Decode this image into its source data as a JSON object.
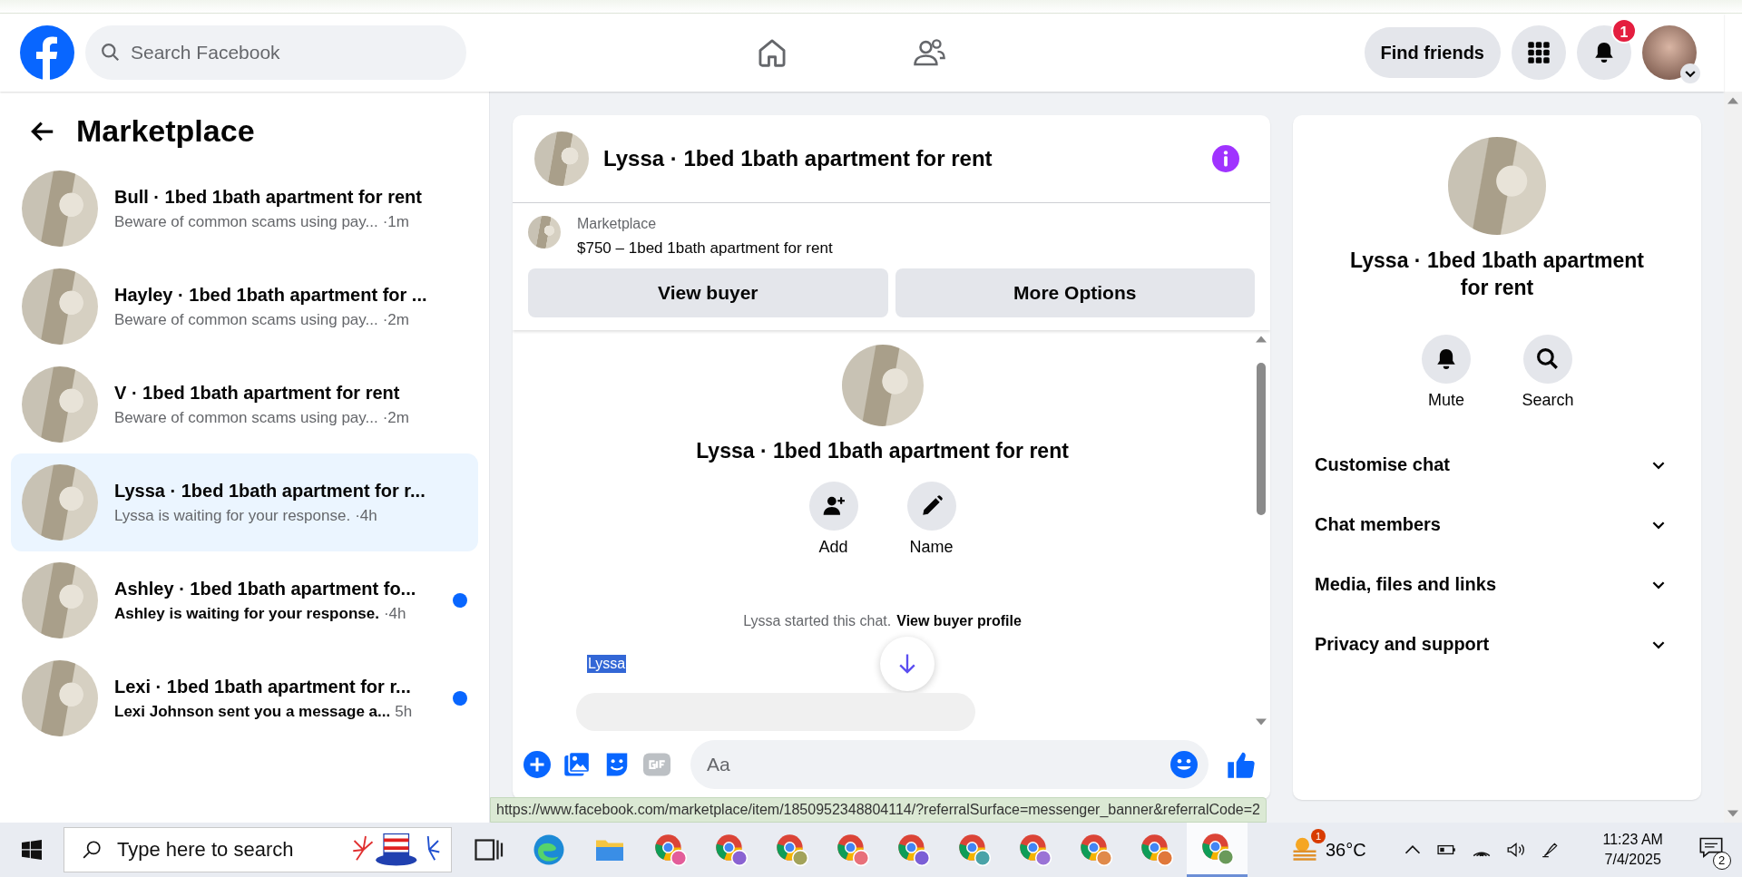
{
  "header": {
    "search": {
      "placeholder": "Search Facebook"
    },
    "find_friends": "Find friends",
    "notifications_badge": "1"
  },
  "sidebar": {
    "title": "Marketplace",
    "conversations": [
      {
        "title": "Bull · 1bed 1bath apartment for rent",
        "preview": "Beware of common scams using pay...",
        "time": "·1m",
        "selected": false,
        "unread": false
      },
      {
        "title": "Hayley · 1bed 1bath apartment for ...",
        "preview": "Beware of common scams using pay...",
        "time": "·2m",
        "selected": false,
        "unread": false
      },
      {
        "title": "V · 1bed 1bath apartment for rent",
        "preview": "Beware of common scams using pay...",
        "time": "·2m",
        "selected": false,
        "unread": false
      },
      {
        "title": "Lyssa · 1bed 1bath apartment for r...",
        "preview": "Lyssa is waiting for your response.",
        "time": "·4h",
        "selected": true,
        "unread": false
      },
      {
        "title": "Ashley · 1bed 1bath apartment fo...",
        "preview": "Ashley is waiting for your response.",
        "time": "·4h",
        "selected": false,
        "unread": true
      },
      {
        "title": "Lexi · 1bed 1bath apartment for r...",
        "preview": "Lexi Johnson sent you a message a...",
        "time": "5h",
        "selected": false,
        "unread": true
      }
    ]
  },
  "chat": {
    "title": "Lyssa · 1bed 1bath apartment for rent",
    "listing": {
      "source": "Marketplace",
      "summary": "$750 – 1bed 1bath apartment for rent"
    },
    "listing_buttons": [
      "View buyer",
      "More Options"
    ],
    "intro": {
      "title": "Lyssa · 1bed 1bath apartment for rent",
      "actions": [
        {
          "kind": "add",
          "label": "Add"
        },
        {
          "kind": "name",
          "label": "Name"
        }
      ],
      "started": "Lyssa started this chat.",
      "profile_link": "View buyer profile"
    },
    "sender_label": "Lyssa",
    "composer": {
      "placeholder": "Aa"
    }
  },
  "details": {
    "title": "Lyssa · 1bed 1bath apartment for rent",
    "actions": [
      {
        "kind": "mute",
        "label": "Mute"
      },
      {
        "kind": "search",
        "label": "Search"
      }
    ],
    "sections": [
      {
        "label": "Customise chat",
        "expanded": false
      },
      {
        "label": "Chat members",
        "expanded": false
      },
      {
        "label": "Media, files and links",
        "expanded": false
      },
      {
        "label": "Privacy and support",
        "expanded": false
      }
    ]
  },
  "status_url": "https://www.facebook.com/marketplace/item/1850952348804114/?referralSurface=messenger_banner&referralCode=2",
  "taskbar": {
    "search_placeholder": "Type here to search",
    "apps": [
      {
        "kind": "taskview",
        "active": false
      },
      {
        "kind": "edge",
        "active": false
      },
      {
        "kind": "explorer",
        "active": false
      },
      {
        "kind": "chrome",
        "active": false,
        "color": "#e35d9a"
      },
      {
        "kind": "chrome",
        "active": false,
        "color": "#8a63d2"
      },
      {
        "kind": "chrome",
        "active": false,
        "color": "#a3a35a"
      },
      {
        "kind": "chrome",
        "active": false,
        "color": "#e8707a"
      },
      {
        "kind": "chrome",
        "active": false,
        "color": "#7b5fd6"
      },
      {
        "kind": "chrome",
        "active": false,
        "color": "#4aa3a8"
      },
      {
        "kind": "chrome",
        "active": false,
        "color": "#9a73d6"
      },
      {
        "kind": "chrome",
        "active": false,
        "color": "#e08a4a"
      },
      {
        "kind": "chrome",
        "active": false,
        "color": "#e0783a"
      },
      {
        "kind": "chrome",
        "active": true,
        "color": "#6a9a5a"
      }
    ],
    "weather": {
      "temp": "36°C",
      "badge": "1"
    },
    "time": "11:23 AM",
    "date": "7/4/2025",
    "notifications": "2"
  }
}
